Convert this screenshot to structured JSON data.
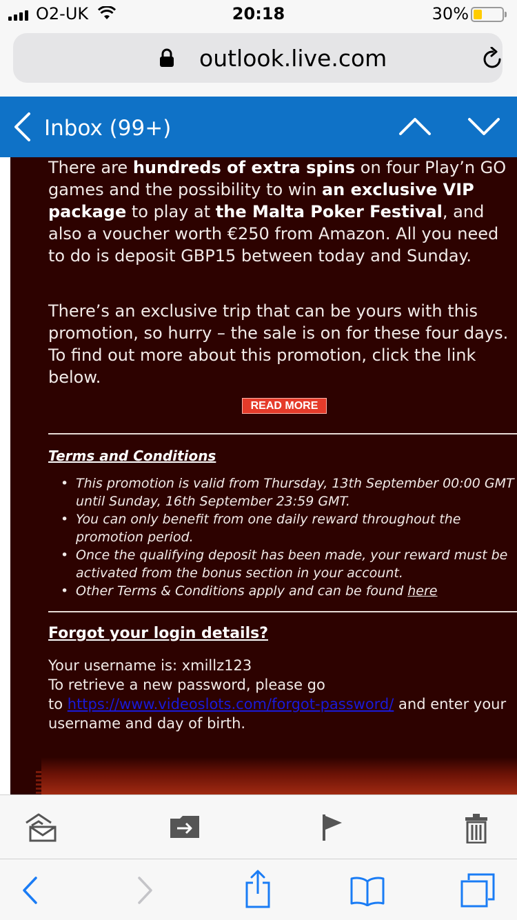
{
  "status_bar": {
    "carrier": "O2-UK",
    "time": "20:18",
    "battery_percent": "30%",
    "battery_level": 0.3,
    "signal_icon": "cellular-signal-icon",
    "wifi_icon": "wifi-icon",
    "battery_icon": "battery-icon"
  },
  "address_bar": {
    "url": "outlook.live.com",
    "lock_icon": "lock-icon",
    "reload_icon": "reload-icon"
  },
  "mail_header": {
    "back_label": "Inbox (99+)",
    "back_icon": "chevron-left-icon",
    "prev_icon": "chevron-up-icon",
    "next_icon": "chevron-down-icon",
    "background_color": "#0f72c7"
  },
  "email": {
    "panel_color": "#2d0200",
    "paragraph1": [
      {
        "text": "There are ",
        "bold": false
      },
      {
        "text": "hundreds of extra spins",
        "bold": true
      },
      {
        "text": " on four Play’n GO games and the possibility to win ",
        "bold": false
      },
      {
        "text": "an exclusive VIP package",
        "bold": true
      },
      {
        "text": " to play at ",
        "bold": false
      },
      {
        "text": "the Malta Poker Festival",
        "bold": true
      },
      {
        "text": ", and also a voucher worth €250 from Amazon. All you need to do is deposit GBP15 between today and Sunday.",
        "bold": false
      }
    ],
    "paragraph2": "There’s an exclusive trip that can be yours with this promotion, so hurry – the sale is on for these four days. To find out more about this promotion, click the link below.",
    "read_more_label": "READ MORE",
    "read_more_color": "#e53b2a",
    "terms_heading": "Terms and Conditions",
    "terms": [
      "This promotion is valid from Thursday, 13th September 00:00 GMT until Sunday, 16th September 23:59 GMT.",
      "You can only benefit from one daily reward throughout the promotion period.",
      "Once the qualifying deposit has been made, your reward must be activated from the bonus section in your account."
    ],
    "terms_last_prefix": "Other Terms & Conditions apply and can be found ",
    "terms_last_link": "here",
    "forgot_heading": "Forgot your login details?",
    "forgot_username_line": "Your username is: xmillz123",
    "forgot_retrieve_line": "To retrieve a new password, please go",
    "forgot_to": "to ",
    "forgot_link": "https://www.videoslots.com/forgot-password/",
    "forgot_suffix": " and enter your username and day of birth.",
    "link_color": "#1a1ad8"
  },
  "mail_toolbar": {
    "reply_icon": "reply-envelope-icon",
    "move_icon": "move-to-folder-icon",
    "flag_icon": "flag-icon",
    "delete_icon": "trash-icon"
  },
  "safari_toolbar": {
    "back_icon": "back-arrow-icon",
    "forward_icon": "forward-arrow-icon",
    "share_icon": "share-icon",
    "bookmarks_icon": "bookmarks-icon",
    "tabs_icon": "tabs-icon",
    "tint": "#1a7cf5"
  }
}
